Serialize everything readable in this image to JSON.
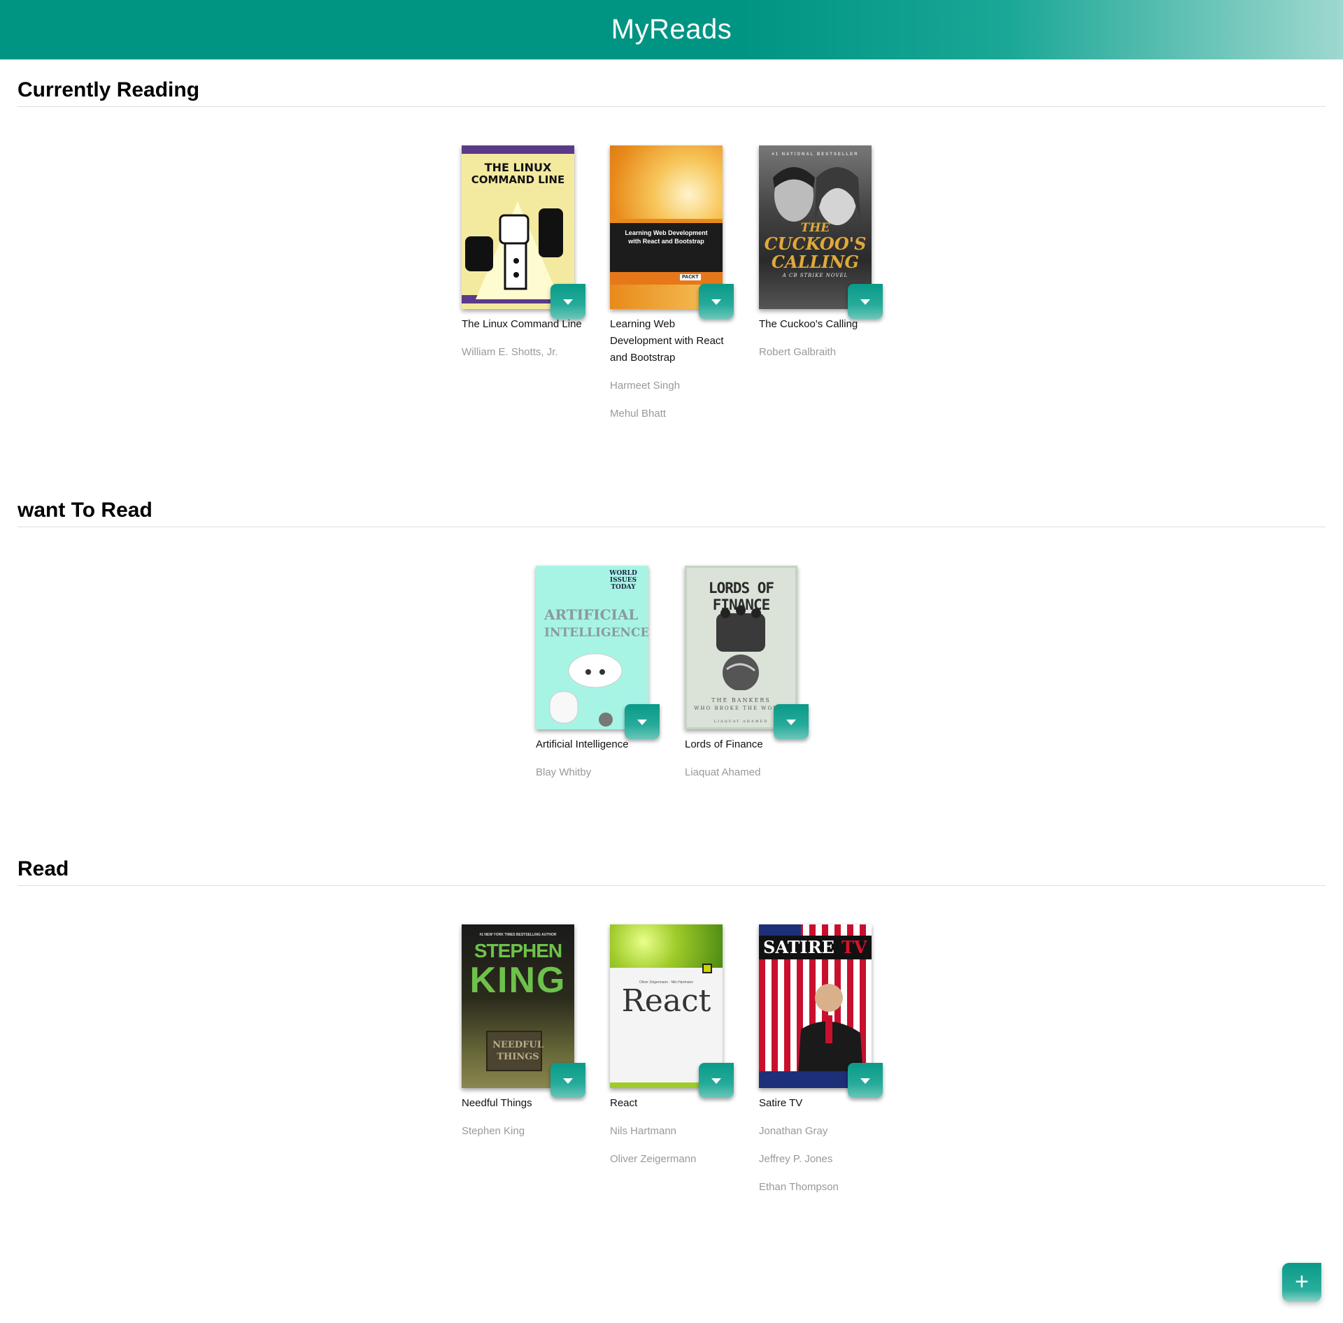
{
  "app": {
    "title": "MyReads"
  },
  "shelves": [
    {
      "title": "Currently Reading",
      "books": [
        {
          "title": "The Linux Command Line",
          "authors": [
            "William E. Shotts, Jr."
          ],
          "cover": "linux-cover"
        },
        {
          "title": "Learning Web Development with React and Bootstrap",
          "authors": [
            "Harmeet Singh",
            "Mehul Bhatt"
          ],
          "cover": "react-bootstrap-cover"
        },
        {
          "title": "The Cuckoo's Calling",
          "authors": [
            "Robert Galbraith"
          ],
          "cover": "cuckoo-cover"
        }
      ]
    },
    {
      "title": "want To Read",
      "books": [
        {
          "title": "Artificial Intelligence",
          "authors": [
            "Blay Whitby"
          ],
          "cover": "ai-cover"
        },
        {
          "title": "Lords of Finance",
          "authors": [
            "Liaquat Ahamed"
          ],
          "cover": "finance-cover"
        }
      ]
    },
    {
      "title": "Read",
      "books": [
        {
          "title": "Needful Things",
          "authors": [
            "Stephen King"
          ],
          "cover": "needful-cover"
        },
        {
          "title": "React",
          "authors": [
            "Nils Hartmann",
            "Oliver Zeigermann"
          ],
          "cover": "react-cover"
        },
        {
          "title": "Satire TV",
          "authors": [
            "Jonathan Gray",
            "Jeffrey P. Jones",
            "Ethan Thompson"
          ],
          "cover": "satire-cover"
        }
      ]
    }
  ],
  "covers": {
    "linux": {
      "line1": "THE LINUX",
      "line2": "COMMAND LINE"
    },
    "react_bootstrap": {
      "line1": "Learning Web Development",
      "line2": "with React and Bootstrap",
      "publisher": "PACKT"
    },
    "cuckoo": {
      "top": "#1 NATIONAL BESTSELLER",
      "line1": "THE",
      "line2": "CUCKOO'S",
      "line3": "CALLING",
      "sub": "A CB STRIKE NOVEL"
    },
    "ai": {
      "badge": "WORLD ISSUES TODAY",
      "line1": "ARTIFICIAL",
      "line2": "INTELLIGENCE"
    },
    "finance": {
      "line1": "LORDS OF FINANCE",
      "line2": "THE BANKERS",
      "line3": "WHO BROKE THE WORLD",
      "line4": "LIAQUAT AHAMED"
    },
    "needful": {
      "top": "#1 NEW YORK TIMES BESTSELLING AUTHOR",
      "line1": "STEPHEN",
      "line2": "KING",
      "sign1": "NEEDFUL",
      "sign2": "THINGS"
    },
    "react": {
      "authors": "Oliver Zeigermann · Nils Hartmann",
      "title": "React"
    },
    "satire": {
      "line1": "SATIRE",
      "line2": "TV"
    }
  },
  "fab": {
    "label": "+"
  }
}
